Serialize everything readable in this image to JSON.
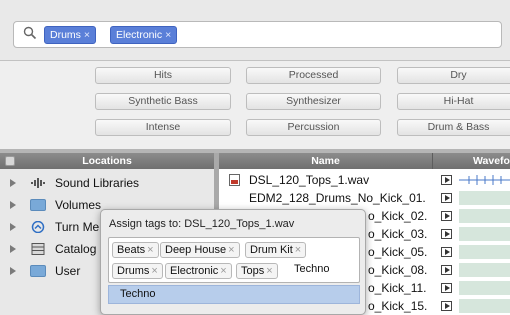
{
  "search": {
    "tokens": [
      {
        "label": "Drums",
        "remove": "×"
      },
      {
        "label": "Electronic",
        "remove": "×"
      }
    ]
  },
  "filters": {
    "row1": [
      "Hits",
      "Processed",
      "Dry"
    ],
    "row2": [
      "Synthetic Bass",
      "Synthesizer",
      "Hi-Hat"
    ],
    "row3": [
      "Intense",
      "Percussion",
      "Drum & Bass"
    ]
  },
  "locations": {
    "header": "Locations",
    "items": [
      {
        "label": "Sound Libraries",
        "icon": "sound-libraries-icon"
      },
      {
        "label": "Volumes",
        "icon": "folder-icon"
      },
      {
        "label": "Turn Me",
        "icon": "turn-me-icon"
      },
      {
        "label": "Catalog",
        "icon": "catalog-icon"
      },
      {
        "label": "User",
        "icon": "folder-icon"
      }
    ]
  },
  "files": {
    "header_name": "Name",
    "header_wave": "Wavefo",
    "rows": [
      "DSL_120_Tops_1.wav",
      "EDM2_128_Drums_No_Kick_01.",
      "o_Kick_02.",
      "o_Kick_03.",
      "o_Kick_05.",
      "o_Kick_08.",
      "o_Kick_11.",
      "o_Kick_15."
    ]
  },
  "popover": {
    "title": "Assign tags to: DSL_120_Tops_1.wav",
    "tags_row1": [
      "Beats",
      "Deep House",
      "Drum Kit"
    ],
    "tags_row2": [
      "Drums",
      "Electronic",
      "Tops"
    ],
    "typed": "Techno",
    "suggestion": "Techno",
    "tag_remove": "×"
  },
  "colors": {
    "token": "#5a7fd8",
    "suggestion_highlight": "#b7cdeb",
    "header": "#7a7a7a"
  }
}
